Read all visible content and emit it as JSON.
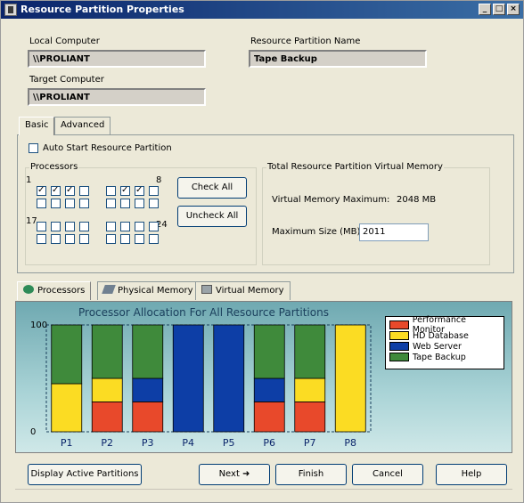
{
  "window": {
    "title": "Resource Partition Properties",
    "controls": [
      "_",
      "□",
      "×"
    ]
  },
  "header": {
    "local_computer_label": "Local Computer",
    "local_computer_value": "\\\\PROLIANT",
    "partition_name_label": "Resource Partition Name",
    "partition_name_value": "Tape Backup",
    "target_computer_label": "Target Computer",
    "target_computer_value": "\\\\PROLIANT"
  },
  "top_tabs": [
    {
      "label": "Basic",
      "active": true
    },
    {
      "label": "Advanced",
      "active": false
    }
  ],
  "basic": {
    "auto_start_label": "Auto Start Resource Partition",
    "auto_start_checked": false,
    "processors_group_label": "Processors",
    "proc_label_1": "1",
    "proc_label_8": "8",
    "proc_label_17": "17",
    "proc_label_24": "24",
    "processor_rows": [
      [
        true,
        true,
        true,
        false,
        false,
        true,
        true,
        false
      ],
      [
        false,
        false,
        false,
        false,
        false,
        false,
        false,
        false
      ],
      [
        false,
        false,
        false,
        false,
        false,
        false,
        false,
        false
      ],
      [
        false,
        false,
        false,
        false,
        false,
        false,
        false,
        false
      ]
    ],
    "check_all_label": "Check All",
    "uncheck_all_label": "Uncheck All",
    "memory_group_label": "Total Resource Partition Virtual Memory",
    "vm_max_label": "Virtual Memory Maximum:",
    "vm_max_value": "2048 MB",
    "max_size_label": "Maximum Size (MB):",
    "max_size_value": "2011"
  },
  "bottom_tabs": [
    {
      "label": "Processors",
      "icon": "processor-icon",
      "active": true
    },
    {
      "label": "Physical Memory",
      "icon": "memory-icon",
      "active": false
    },
    {
      "label": "Virtual Memory",
      "icon": "disk-icon",
      "active": false
    }
  ],
  "chart_data": {
    "type": "bar",
    "stacked": true,
    "title": "Processor Allocation For All Resource Partitions",
    "categories": [
      "P1",
      "P2",
      "P3",
      "P4",
      "P5",
      "P6",
      "P7",
      "P8"
    ],
    "ylim": [
      0,
      100
    ],
    "yticks": [
      "0",
      "100"
    ],
    "series": [
      {
        "name": "Performance Monitor",
        "color": "#e8492b",
        "values": [
          0,
          28,
          28,
          0,
          0,
          28,
          28,
          0
        ]
      },
      {
        "name": "HD Database",
        "color": "#fbdc23",
        "values": [
          45,
          22,
          0,
          0,
          0,
          0,
          22,
          100
        ]
      },
      {
        "name": "Web Server",
        "color": "#0d3ea6",
        "values": [
          0,
          0,
          22,
          100,
          100,
          22,
          0,
          0
        ]
      },
      {
        "name": "Tape Backup",
        "color": "#3f8a3b",
        "values": [
          55,
          50,
          50,
          0,
          0,
          50,
          50,
          0
        ]
      }
    ],
    "legend_position": "top-right"
  },
  "footer": {
    "display_active_label": "Display Active Partitions",
    "next_label": "Next",
    "finish_label": "Finish",
    "cancel_label": "Cancel",
    "help_label": "Help"
  }
}
